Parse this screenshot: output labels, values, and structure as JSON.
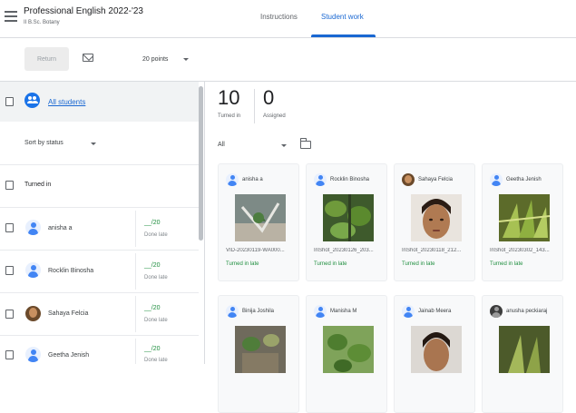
{
  "header": {
    "course_title": "Professional English 2022-'23",
    "course_subtitle": "II B.Sc. Botany",
    "tabs": [
      {
        "label": "Instructions",
        "active": false
      },
      {
        "label": "Student work",
        "active": true
      }
    ],
    "accent_color": "#1967d2"
  },
  "toolbar": {
    "return_label": "Return",
    "mail_icon": "mail-icon",
    "points_value": "20 points"
  },
  "left_panel": {
    "all_students_label": "All students",
    "sort_label": "Sort by status",
    "section_label": "Turned in",
    "students": [
      {
        "name": "anisha a",
        "grade": "__/20",
        "status": "Done late",
        "avatar": "default"
      },
      {
        "name": "Rocklin Binosha",
        "grade": "__/20",
        "status": "Done late",
        "avatar": "default"
      },
      {
        "name": "Sahaya Felcia",
        "grade": "__/20",
        "status": "Done late",
        "avatar": "photo"
      },
      {
        "name": "Geetha Jenish",
        "grade": "__/20",
        "status": "Done late",
        "avatar": "default"
      }
    ]
  },
  "stats": {
    "turned_in": {
      "value": "10",
      "label": "Turned in"
    },
    "assigned": {
      "value": "0",
      "label": "Assigned"
    }
  },
  "filter": {
    "value": "All"
  },
  "cards": [
    {
      "name": "anisha a",
      "file": "VID-20230119-WA000...",
      "status": "Turned in late",
      "avatar": "default"
    },
    {
      "name": "Rocklin Binosha",
      "file": "InShot_20230126_203...",
      "status": "Turned in late",
      "avatar": "default"
    },
    {
      "name": "Sahaya Felcia",
      "file": "InShot_20230118_212...",
      "status": "Turned in late",
      "avatar": "photo"
    },
    {
      "name": "Geetha Jenish",
      "file": "InShot_20230302_143...",
      "status": "Turned in late",
      "avatar": "default"
    },
    {
      "name": "Binija Joshila",
      "file": "",
      "status": "",
      "avatar": "default"
    },
    {
      "name": "Manisha M",
      "file": "",
      "status": "",
      "avatar": "default"
    },
    {
      "name": "Jainab Meera",
      "file": "",
      "status": "",
      "avatar": "default"
    },
    {
      "name": "anusha peckiaraj",
      "file": "",
      "status": "",
      "avatar": "dark"
    }
  ]
}
